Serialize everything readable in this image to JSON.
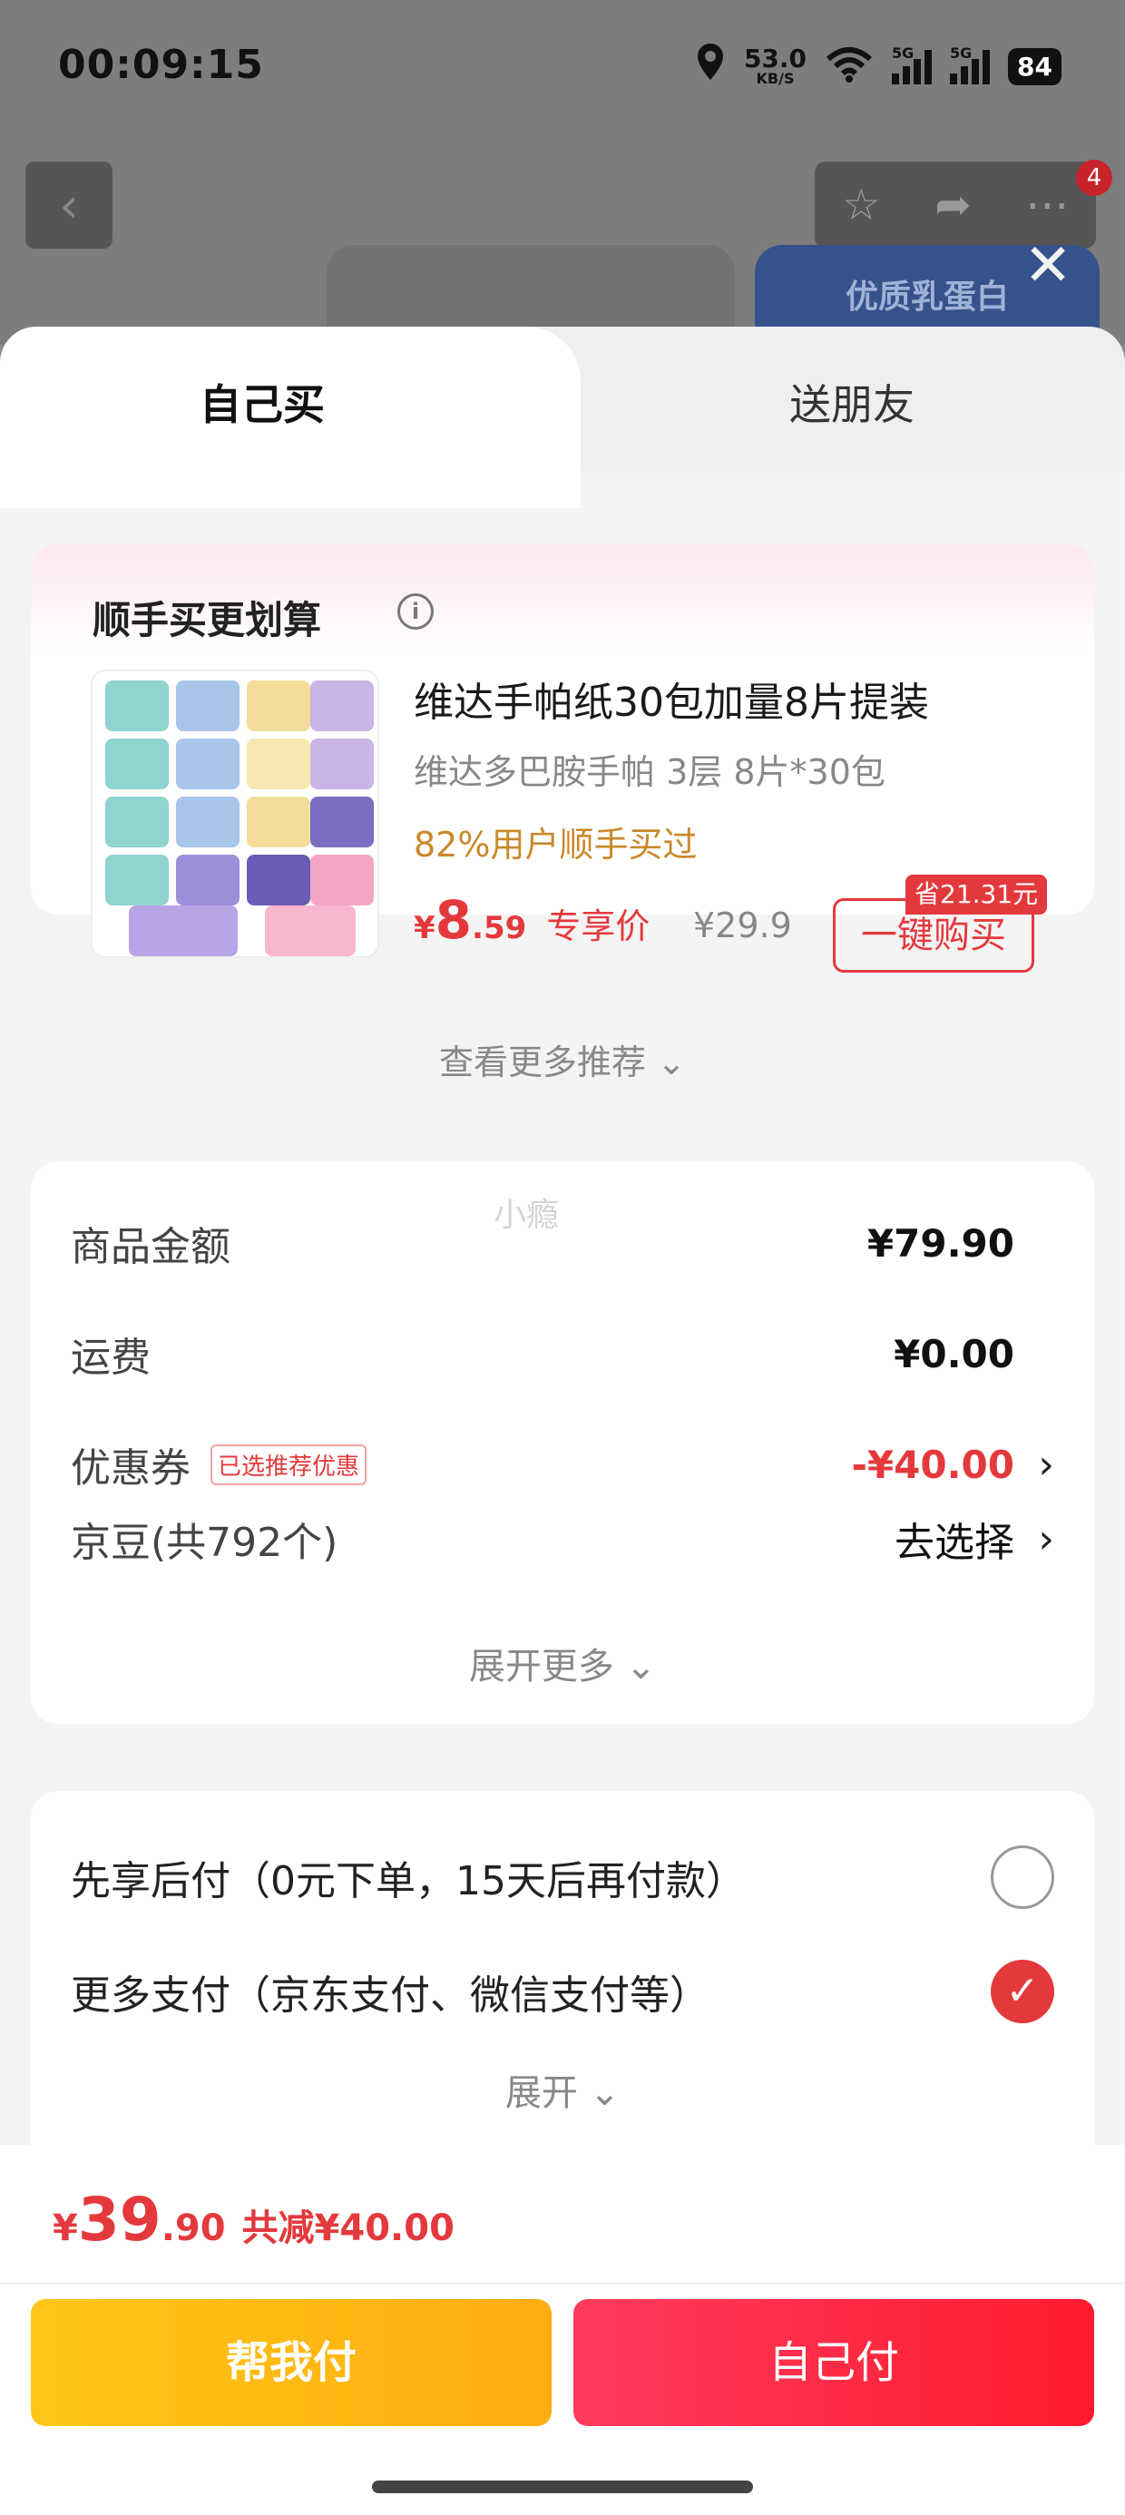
{
  "status_bar": {
    "time": "00:09:15",
    "net_speed": "53.0",
    "net_unit": "KB/S",
    "signal_1": "5G",
    "signal_2": "5G",
    "battery": "84"
  },
  "background": {
    "notification_count": "4",
    "promo_text": "优质乳蛋白"
  },
  "tabs": {
    "self": "自己买",
    "friend": "送朋友"
  },
  "recommend": {
    "title": "顺手买更划算",
    "product_name": "维达手帕纸30包加量8片提装",
    "product_spec": "维达多巴胺手帕 3层 8片*30包",
    "buy_rate": "82%用户顺手买过",
    "price_currency": "¥",
    "price_int": "8",
    "price_dec": ".59",
    "exclusive_label": "专享价",
    "original_price": "¥29.9",
    "buy_button": "一键购买",
    "save_tag": "省21.31元",
    "more": "查看更多推荐"
  },
  "summary": {
    "watermark": "小瘾",
    "rows": [
      {
        "label": "商品金额",
        "value": "¥79.90"
      },
      {
        "label": "运费",
        "value": "¥0.00"
      },
      {
        "label": "优惠券",
        "tag": "已选推荐优惠",
        "value": "-¥40.00"
      },
      {
        "label": "京豆(共792个)",
        "value": "去选择"
      }
    ],
    "expand": "展开更多"
  },
  "payment": {
    "options": [
      {
        "label": "先享后付（0元下单，15天后再付款）",
        "selected": false
      },
      {
        "label": "更多支付（京东支付、微信支付等）",
        "selected": true
      }
    ],
    "expand": "展开"
  },
  "bottom": {
    "currency": "¥",
    "total_int": "39",
    "total_dec": ".90",
    "reduce": "共减¥40.00",
    "help_pay": "帮我付",
    "self_pay": "自己付"
  },
  "colors": {
    "accent_red": "#e4393c",
    "help_yellow": "#ffb714",
    "self_red": "#ff2a44"
  }
}
